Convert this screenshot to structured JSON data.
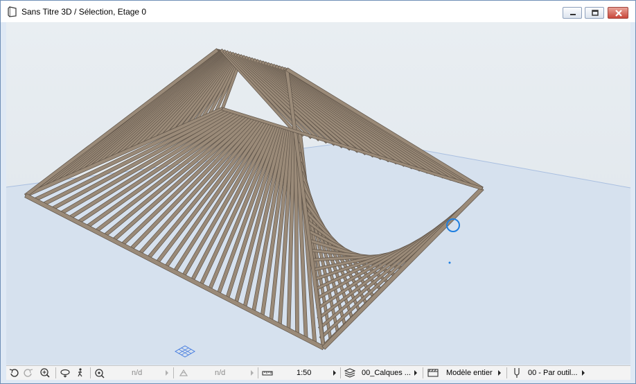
{
  "window": {
    "title": "Sans Titre 3D / Sélection, Etage 0"
  },
  "icons": {
    "window": "window-icon",
    "minimize": "minimize-icon",
    "maximize": "maximize-icon",
    "close": "close-icon"
  },
  "statusbar": {
    "undo_icon": "undo-view-icon",
    "redo_icon": "redo-view-icon",
    "zoom_icon": "zoom-icon",
    "orbit_icon": "orbit-icon",
    "walk_icon": "walk-icon",
    "zoom_value": "n/d",
    "angle_value": "n/d",
    "scale": "1:50",
    "layers": "00_Calques ...",
    "model_view": "Modèle entier",
    "pen_set": "00 - Par outil..."
  },
  "colors": {
    "rafter": "#9a8a78",
    "rafter_edge": "#5e5348",
    "ground": "#d6e1ee",
    "sky": "#e6ebef",
    "cursor": "#1f7fe0"
  }
}
